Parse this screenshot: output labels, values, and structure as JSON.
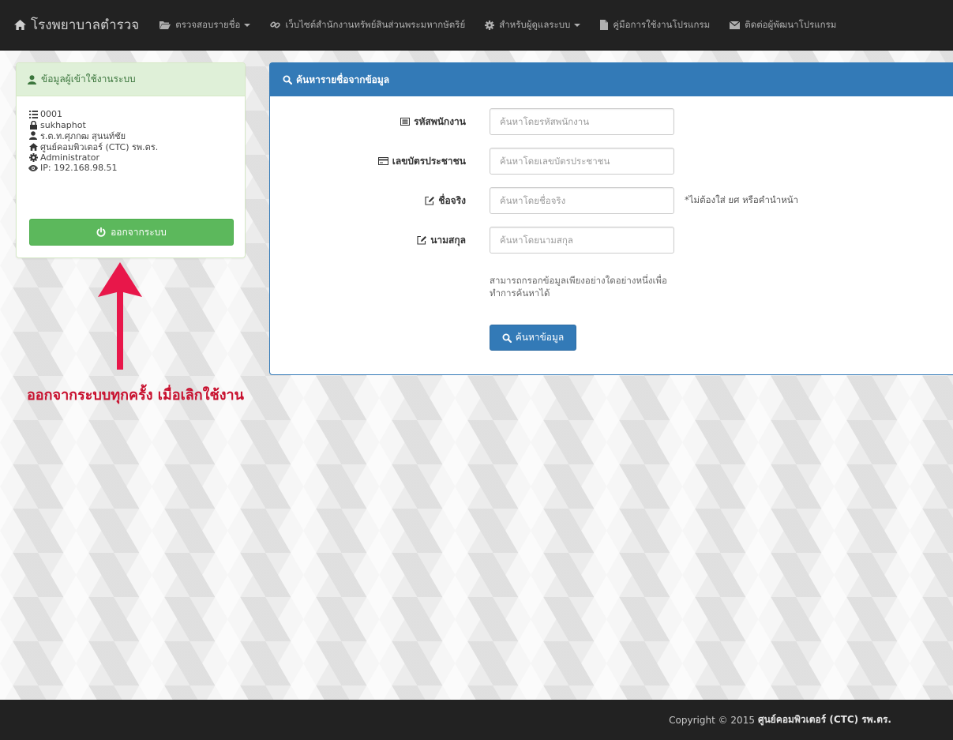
{
  "navbar": {
    "brand": "โรงพยาบาลตำรวจ",
    "items": [
      {
        "label": "ตรวจสอบรายชื่อ"
      },
      {
        "label": "เว็บไซต์สำนักงานทรัพย์สินส่วนพระมหากษัตริย์"
      },
      {
        "label": "สำหรับผู้ดูแลระบบ"
      },
      {
        "label": "คู่มือการใช้งานโปรแกรม"
      },
      {
        "label": "ติดต่อผู้พัฒนาโปรแกรม"
      }
    ]
  },
  "user_panel": {
    "title": "ข้อมูลผู้เข้าใช้งานระบบ",
    "id": "0001",
    "username": "sukhaphot",
    "fullname": "ร.ต.ท.ศุภกฒ สุนนท์ชัย",
    "department": "ศูนย์คอมพิวเตอร์ (CTC) รพ.ตร.",
    "role": "Administrator",
    "ip": "IP: 192.168.98.51",
    "logout_label": "ออกจากระบบ"
  },
  "annotation": {
    "text": "ออกจากระบบทุกครั้ง เมื่อเลิกใช้งาน",
    "color": "#e8174a"
  },
  "search_panel": {
    "title": "ค้นหารายชื่อจากข้อมูล",
    "fields": [
      {
        "label": "รหัสพนักงาน",
        "placeholder": "ค้นหาโดยรหัสพนักงาน",
        "value": ""
      },
      {
        "label": "เลขบัตรประชาชน",
        "placeholder": "ค้นหาโดยเลขบัตรประชาชน",
        "value": ""
      },
      {
        "label": "ชื่อจริง",
        "placeholder": "ค้นหาโดยชื่อจริง",
        "value": ""
      },
      {
        "label": "นามสกุล",
        "placeholder": "ค้นหาโดยนามสกุล",
        "value": ""
      }
    ],
    "name_hint": "*ไม่ต้องใส่ ยศ หรือคำนำหน้า",
    "help_text": "สามารถกรอกข้อมูลเพียงอย่างใดอย่างหนึ่งเพื่อทำการค้นหาได้",
    "search_label": "ค้นหาข้อมูล"
  },
  "footer": {
    "copyright": "Copyright © 2015",
    "org": "ศูนย์คอมพิวเตอร์ (CTC) รพ.ตร."
  },
  "colors": {
    "navbar_bg": "#222222",
    "success_green": "#5cb85c",
    "panel_green_header": "#dff0d8",
    "primary_blue": "#337ab7",
    "annotation_red": "#e8174a"
  },
  "icons": {
    "brand": "home-icon",
    "check_names": "folder-open-icon",
    "website": "link-icon",
    "admin": "gear-icon",
    "manual": "file-icon",
    "contact": "envelope-icon",
    "user_panel": "user-icon",
    "id": "list-icon",
    "username": "lock-icon",
    "fullname": "user-icon",
    "department": "home-icon",
    "role": "gear-icon",
    "ip": "eye-icon",
    "logout": "power-icon",
    "search": "search-icon",
    "employee_id": "id-card-icon",
    "citizen_id": "credit-card-icon",
    "first_name": "edit-icon",
    "last_name": "edit-icon"
  }
}
